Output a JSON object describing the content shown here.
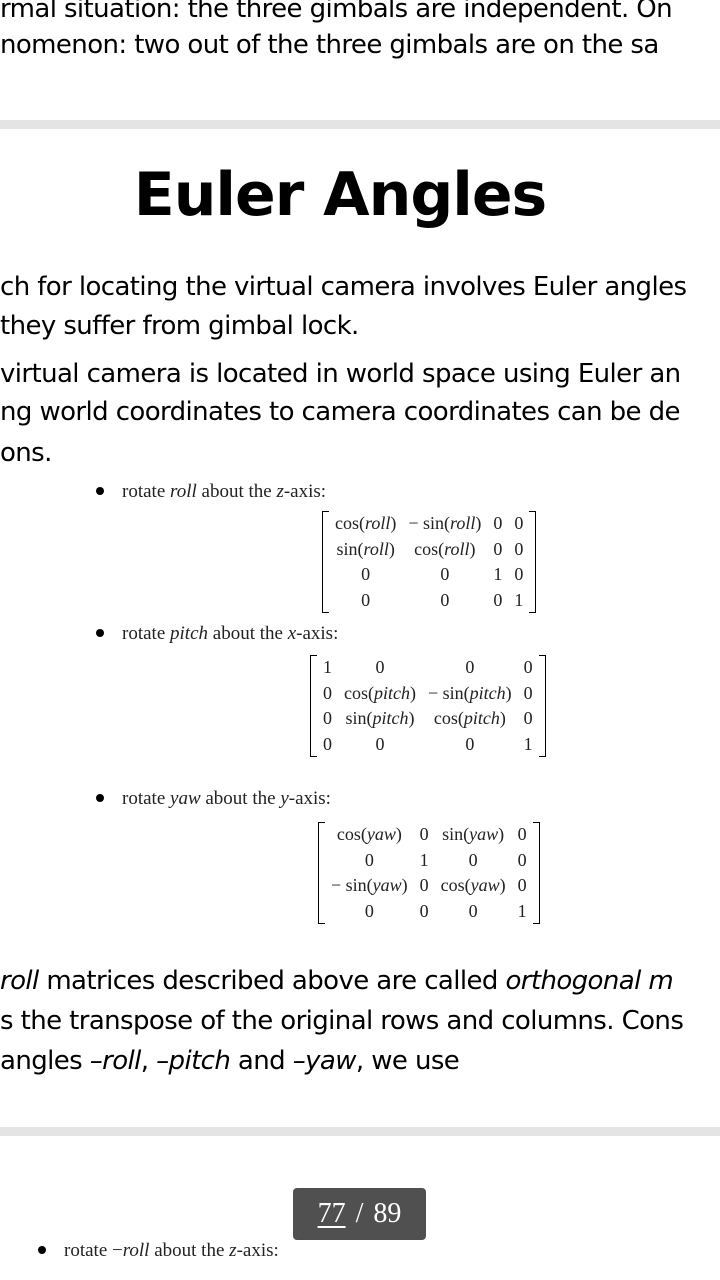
{
  "page1": {
    "lines": [
      "rmal situation: the three gimbals are independent. On",
      "nomenon: two out of the three gimbals are on the sa"
    ]
  },
  "page2": {
    "title": "Euler Angles",
    "para_lines": [
      "ch for locating the virtual camera involves Euler angles",
      "they suffer from gimbal lock.",
      "virtual camera is located in world space using Euler an",
      "ng world coordinates to camera coordinates can be de",
      "ons."
    ],
    "bullets": [
      {
        "pre": "rotate ",
        "var": "roll",
        "post": " about the ",
        "axis": "z",
        "end": "-axis:"
      },
      {
        "pre": "rotate ",
        "var": "pitch",
        "post": " about the ",
        "axis": "x",
        "end": "-axis:"
      },
      {
        "pre": "rotate ",
        "var": "yaw",
        "post": " about the ",
        "axis": "y",
        "end": "-axis:"
      }
    ],
    "matrices": [
      {
        "var": "roll",
        "rows": [
          [
            "cos(roll)",
            "− sin(roll)",
            "0",
            "0"
          ],
          [
            "sin(roll)",
            "cos(roll)",
            "0",
            "0"
          ],
          [
            "0",
            "0",
            "1",
            "0"
          ],
          [
            "0",
            "0",
            "0",
            "1"
          ]
        ]
      },
      {
        "var": "pitch",
        "rows": [
          [
            "1",
            "0",
            "0",
            "0"
          ],
          [
            "0",
            "cos(pitch)",
            "− sin(pitch)",
            "0"
          ],
          [
            "0",
            "sin(pitch)",
            "cos(pitch)",
            "0"
          ],
          [
            "0",
            "0",
            "0",
            "1"
          ]
        ]
      },
      {
        "var": "yaw",
        "rows": [
          [
            "cos(yaw)",
            "0",
            "sin(yaw)",
            "0"
          ],
          [
            "0",
            "1",
            "0",
            "0"
          ],
          [
            "− sin(yaw)",
            "0",
            "cos(yaw)",
            "0"
          ],
          [
            "0",
            "0",
            "0",
            "1"
          ]
        ]
      }
    ],
    "after": {
      "l1_italic": "roll",
      "l1_text": " matrices described above are called ",
      "l1_italic2": "orthogonal m",
      "l2": "s the transpose of the original rows and columns. Cons",
      "l3_a": "angles ",
      "l3_b": "–roll",
      "l3_c": ", ",
      "l3_d": "–pitch",
      "l3_e": " and ",
      "l3_f": "–yaw",
      "l3_g": ", we use"
    }
  },
  "page3": {
    "bullet": {
      "pre": "rotate −",
      "var": "roll",
      "post": " about the ",
      "axis": "z",
      "end": "-axis:"
    }
  },
  "pager": {
    "current": "77",
    "sep": "/",
    "total": "89"
  }
}
